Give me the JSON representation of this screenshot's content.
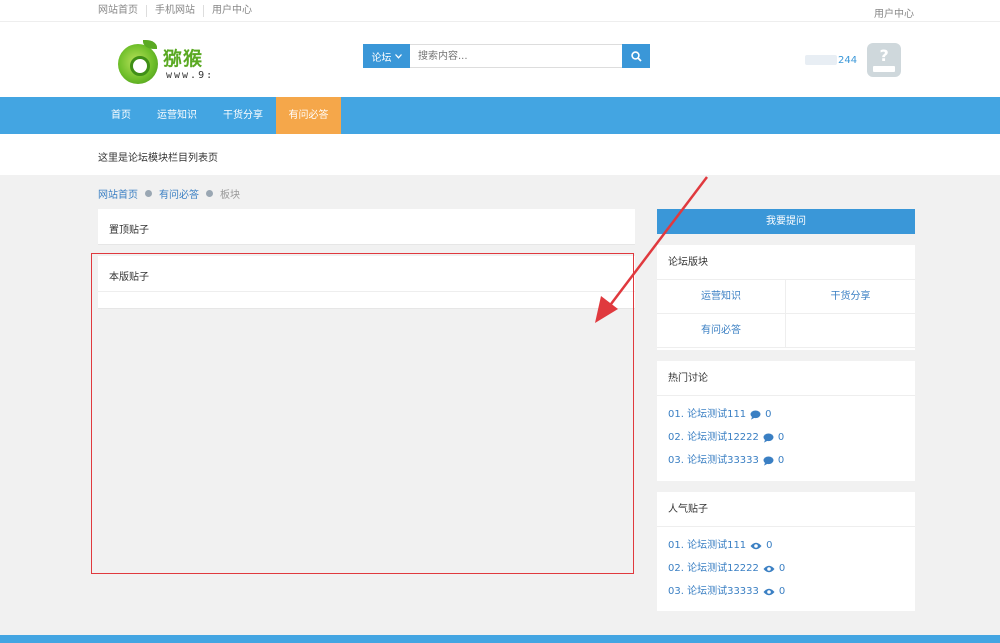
{
  "topbar": {
    "links": [
      "网站首页",
      "手机网站",
      "用户中心"
    ],
    "right": "用户中心"
  },
  "logo": {
    "name": "猕猴",
    "url": "www.9:"
  },
  "search": {
    "category": "论坛",
    "placeholder": "搜索内容..."
  },
  "user": {
    "name_suffix": "244"
  },
  "nav": {
    "items": [
      "首页",
      "运营知识",
      "干货分享",
      "有问必答"
    ],
    "active": "有问必答"
  },
  "subtitle": "这里是论坛模块栏目列表页",
  "breadcrumb": {
    "home": "网站首页",
    "section": "有问必答",
    "current": "板块"
  },
  "main": {
    "sticky_title": "置顶贴子",
    "board_title": "本版贴子"
  },
  "sidebar": {
    "ask_button": "我要提问",
    "boards": {
      "title": "论坛版块",
      "items": [
        "运营知识",
        "干货分享",
        "有问必答",
        ""
      ]
    },
    "hot": {
      "title": "热门讨论",
      "items": [
        {
          "label": "01. 论坛测试111",
          "count": "0"
        },
        {
          "label": "02. 论坛测试12222",
          "count": "0"
        },
        {
          "label": "03. 论坛测试33333",
          "count": "0"
        }
      ]
    },
    "popular": {
      "title": "人气贴子",
      "items": [
        {
          "label": "01. 论坛测试111",
          "count": "0"
        },
        {
          "label": "02. 论坛测试12222",
          "count": "0"
        },
        {
          "label": "03. 论坛测试33333",
          "count": "0"
        }
      ]
    }
  },
  "colors": {
    "brand_blue": "#43a5e2",
    "active_orange": "#f5a74a",
    "annotation_red": "#e0393e"
  }
}
